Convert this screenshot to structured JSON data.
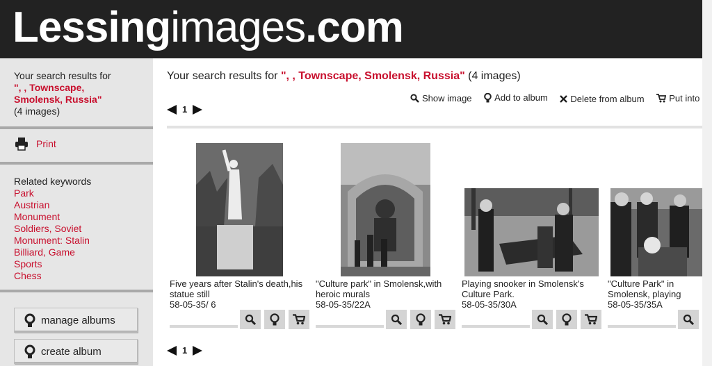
{
  "header": {
    "logo_bold": "Lessing",
    "logo_light": "images",
    "logo_suffix": ".com"
  },
  "sidebar": {
    "search_intro": "Your search results for",
    "search_query": "\", , Townscape, Smolensk, Russia\"",
    "search_count": "(4 images)",
    "print_label": "Print",
    "related_heading": "Related keywords",
    "keywords": [
      "Park",
      "Austrian",
      "Monument",
      "Soldiers, Soviet",
      "Monument: Stalin",
      "Billiard, Game",
      "Sports",
      "Chess"
    ],
    "manage_albums": "manage albums",
    "create_album": "create album"
  },
  "main": {
    "title_intro": "Your search results for ",
    "title_query": "\", , Townscape, Smolensk, Russia\"",
    "title_count": " (4 images)",
    "toolbar": {
      "show_image": "Show image",
      "add_to_album": "Add to album",
      "delete_from_album": "Delete from album",
      "put_into_shop": "Put into shop"
    },
    "pager": {
      "current_page": "1"
    },
    "results": [
      {
        "caption": "Five years after Stalin's death,his statue still",
        "code": "58-05-35/ 6"
      },
      {
        "caption": "\"Culture park\" in Smolensk,with heroic murals",
        "code": "58-05-35/22A"
      },
      {
        "caption": "Playing snooker in Smolensk's Culture Park.",
        "code": "58-05-35/30A"
      },
      {
        "caption": "\"Culture Park\" in Smolensk, playing chess like",
        "code": "58-05-35/35A"
      }
    ]
  },
  "colors": {
    "accent": "#c8102e",
    "header_bg": "#222222",
    "sidebar_bg": "#e6e6e6"
  }
}
